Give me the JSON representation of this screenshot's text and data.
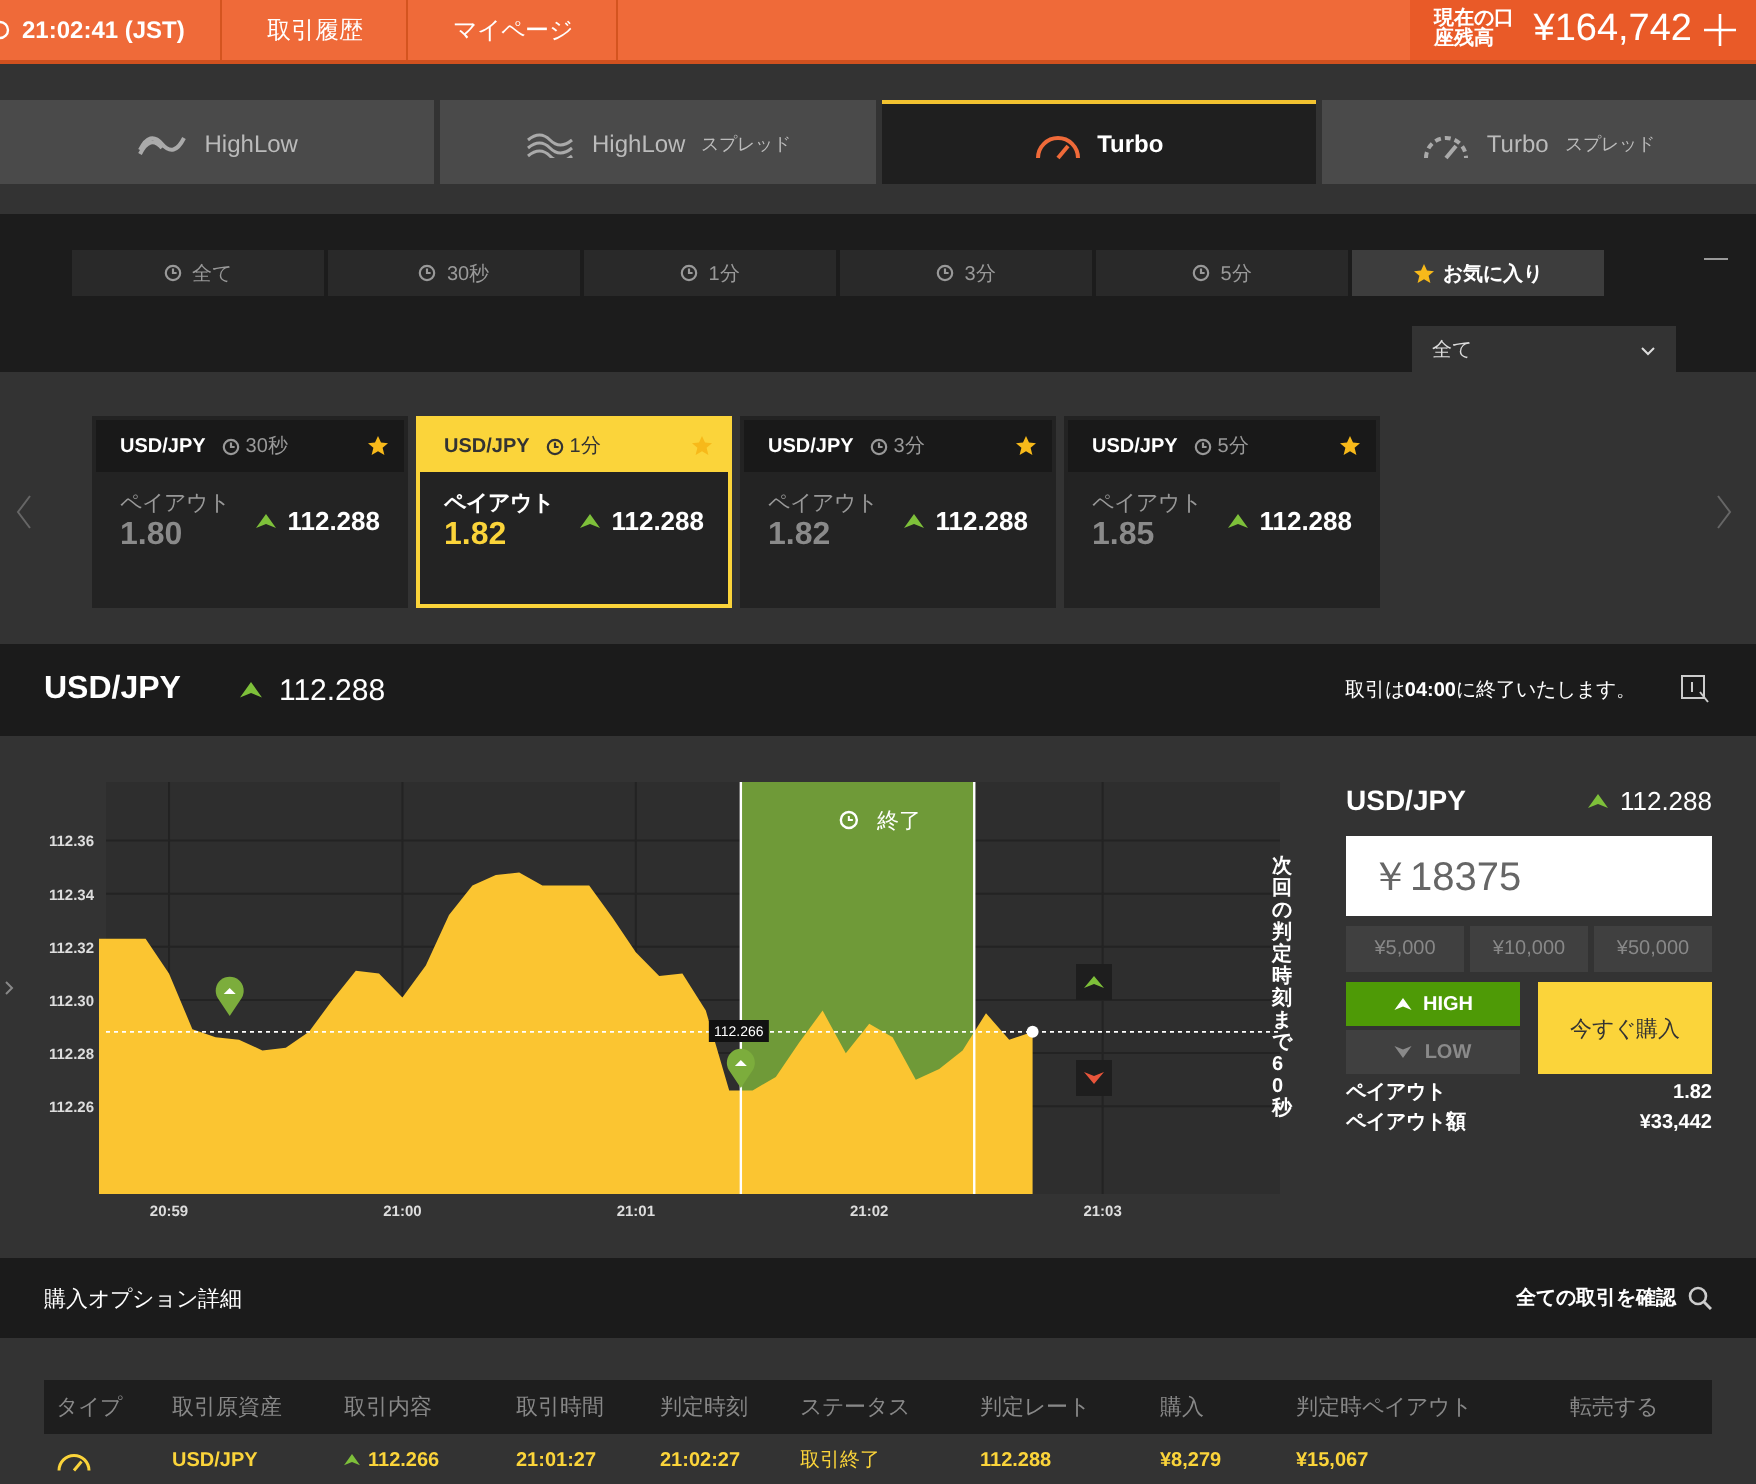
{
  "header": {
    "time": "21:02:41 (JST)",
    "nav": [
      "取引履歴",
      "マイページ"
    ],
    "balance_label": "現在の口座残高",
    "balance": "¥164,742"
  },
  "product_tabs": [
    {
      "kind": "highlow",
      "label": "HighLow",
      "selected": false
    },
    {
      "kind": "highlow-spread",
      "label": "HighLow",
      "suffix": "スプレッド",
      "selected": false
    },
    {
      "kind": "turbo",
      "label": "Turbo",
      "selected": true
    },
    {
      "kind": "turbo-spread",
      "label": "Turbo",
      "suffix": "スプレッド",
      "selected": false
    }
  ],
  "filters": [
    {
      "kind": "clock",
      "label": "全て",
      "selected": false
    },
    {
      "kind": "clock",
      "label": "30秒",
      "selected": false
    },
    {
      "kind": "clock",
      "label": "1分",
      "selected": false
    },
    {
      "kind": "clock",
      "label": "3分",
      "selected": false
    },
    {
      "kind": "clock",
      "label": "5分",
      "selected": false
    },
    {
      "kind": "star",
      "label": "お気に入り",
      "selected": true
    }
  ],
  "asset_dropdown": {
    "value": "全て"
  },
  "cards": [
    {
      "pair": "USD/JPY",
      "duration": "30秒",
      "starred": true,
      "payout_label": "ペイアウト",
      "payout": "1.80",
      "rate": "112.288",
      "selected": false
    },
    {
      "pair": "USD/JPY",
      "duration": "1分",
      "starred": true,
      "payout_label": "ペイアウト",
      "payout": "1.82",
      "rate": "112.288",
      "selected": true
    },
    {
      "pair": "USD/JPY",
      "duration": "3分",
      "starred": true,
      "payout_label": "ペイアウト",
      "payout": "1.82",
      "rate": "112.288",
      "selected": false
    },
    {
      "pair": "USD/JPY",
      "duration": "5分",
      "starred": true,
      "payout_label": "ペイアウト",
      "payout": "1.85",
      "rate": "112.288",
      "selected": false
    }
  ],
  "asset_bar": {
    "pair": "USD/JPY",
    "rate": "112.288",
    "notice": "取引は**04:00**に終了いたします。"
  },
  "chart": {
    "countdown": "次回の判定時刻まで60秒",
    "expiry_label": "終了",
    "entry_tag": "112.266",
    "chart_data": {
      "type": "area",
      "categories": [
        null,
        null,
        null,
        "20:59",
        null,
        null,
        null,
        null,
        null,
        null,
        null,
        null,
        null,
        "21:00",
        null,
        null,
        null,
        null,
        null,
        null,
        null,
        null,
        null,
        "21:01",
        null,
        null,
        null,
        null,
        null,
        null,
        null,
        null,
        null,
        "21:02",
        null,
        null,
        null,
        null,
        null,
        null,
        null,
        null,
        null,
        "21:03",
        null,
        null,
        null,
        null,
        null,
        null,
        null
      ],
      "values": [
        112.323,
        112.323,
        112.323,
        112.31,
        112.289,
        112.286,
        112.285,
        112.281,
        112.282,
        112.288,
        112.3,
        112.311,
        112.31,
        112.301,
        112.313,
        112.332,
        112.343,
        112.347,
        112.348,
        112.343,
        112.343,
        112.343,
        112.331,
        112.318,
        112.309,
        112.31,
        112.296,
        112.266,
        112.266,
        112.271,
        112.284,
        112.296,
        112.28,
        112.291,
        112.286,
        112.27,
        112.274,
        112.281,
        112.295,
        112.285,
        112.288,
        null,
        null,
        null,
        null,
        null,
        null,
        null,
        null,
        null,
        null
      ],
      "ylim": [
        112.227,
        112.382
      ],
      "grid": true,
      "ref_lines": [
        {
          "axis": "y",
          "value": 112.288
        }
      ],
      "yticks": [
        {
          "value": 112.26,
          "label": "112.26"
        },
        {
          "value": 112.28,
          "label": "112.28"
        },
        {
          "value": 112.3,
          "label": "112.30"
        },
        {
          "value": 112.32,
          "label": "112.32"
        },
        {
          "value": 112.34,
          "label": "112.34"
        },
        {
          "value": 112.36,
          "label": "112.36"
        }
      ]
    }
  },
  "trade_panel": {
    "pair": "USD/JPY",
    "rate": "112.288",
    "amount": "￥18375",
    "quick_amounts": [
      "¥5,000",
      "¥10,000",
      "¥50,000"
    ],
    "directions": [
      {
        "kind": "high",
        "label": "HIGH",
        "selected": true
      },
      {
        "kind": "low",
        "label": "LOW",
        "selected": false
      }
    ],
    "buy_button": "今すぐ購入",
    "summary": [
      {
        "label": "ペイアウト",
        "value": "1.82"
      },
      {
        "label": "ペイアウト額",
        "value": "¥33,442"
      }
    ]
  },
  "details": {
    "title": "購入オプション詳細",
    "link": "全ての取引を確認",
    "columns": [
      "タイプ",
      "取引原資産",
      "取引内容",
      "取引時間",
      "判定時刻",
      "ステータス",
      "判定レート",
      "購入",
      "判定時ペイアウト",
      "転売する"
    ],
    "rows": [
      {
        "asset": "USD/JPY",
        "rate": "112.266",
        "trade_time": "21:01:27",
        "expiry": "21:02:27",
        "status": "取引終了",
        "expiry_rate": "112.288",
        "purchase": "¥8,279",
        "payout": "¥15,067"
      }
    ]
  }
}
